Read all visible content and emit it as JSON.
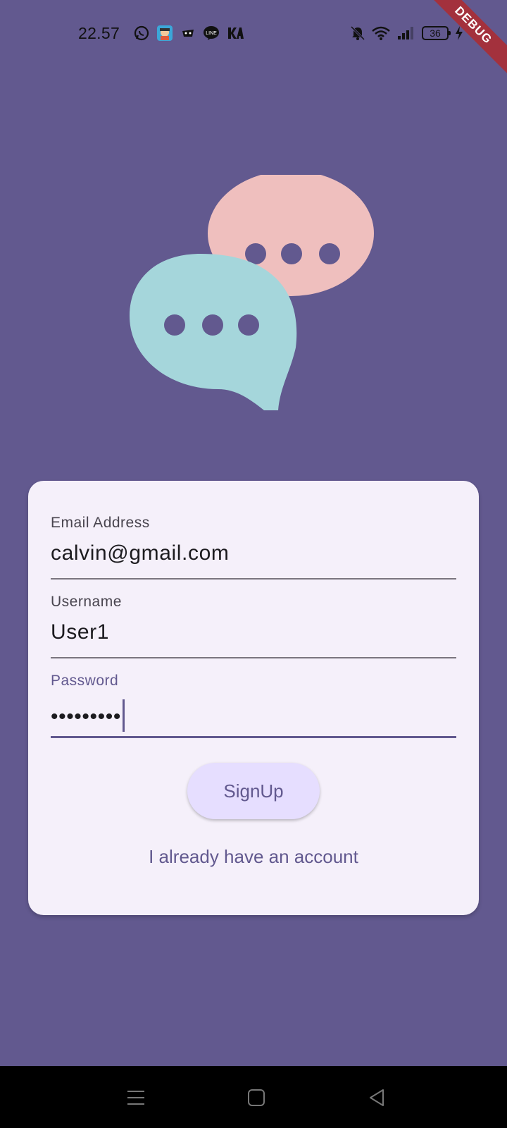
{
  "status_bar": {
    "time": "22.57",
    "battery": "36",
    "left_icons": [
      "whatsapp-icon",
      "avatar-app-icon",
      "ecommerce-icon",
      "line-icon",
      "kai-icon"
    ],
    "right_icons": [
      "mute-icon",
      "wifi-icon",
      "signal-icon",
      "battery-icon",
      "charging-icon"
    ]
  },
  "debug_banner": "DEBUG",
  "logo": {
    "bubble_back_color": "#EFBFBE",
    "bubble_front_color": "#A5D6DB"
  },
  "form": {
    "email": {
      "label": "Email Address",
      "value": "calvin@gmail.com"
    },
    "username": {
      "label": "Username",
      "value": "User1"
    },
    "password": {
      "label": "Password",
      "value": "•••••••••"
    },
    "signup_label": "SignUp",
    "login_link": "I already have an account"
  },
  "nav": {
    "buttons": [
      "menu-icon",
      "home-icon",
      "back-icon"
    ]
  },
  "colors": {
    "background": "#62598F",
    "card": "#F5F0FA",
    "accent": "#62598F",
    "button": "#E6DEFF",
    "debug": "#A3313D"
  }
}
